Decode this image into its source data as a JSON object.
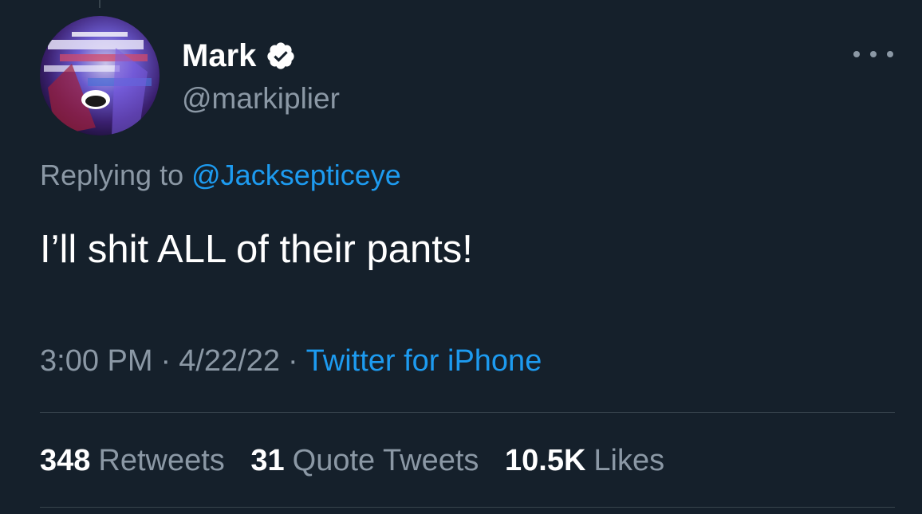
{
  "author": {
    "name": "Mark",
    "handle": "@markiplier",
    "verified": true
  },
  "reply": {
    "prefix": "Replying to",
    "to": "@Jacksepticeye"
  },
  "text": "I’ll shit ALL of their pants!",
  "meta": {
    "time": "3:00 PM",
    "date": "4/22/22",
    "separator": "·",
    "source": "Twitter for iPhone"
  },
  "stats": {
    "retweets": {
      "count": "348",
      "label": "Retweets"
    },
    "quotes": {
      "count": "31",
      "label": "Quote Tweets"
    },
    "likes": {
      "count": "10.5K",
      "label": "Likes"
    }
  },
  "icons": {
    "verified": "verified-badge-icon",
    "more": "more-options-icon"
  },
  "colors": {
    "background": "#15202b",
    "primary_text": "#ffffff",
    "secondary_text": "#8b98a5",
    "link": "#1d9bf0",
    "divider": "#38444d"
  }
}
